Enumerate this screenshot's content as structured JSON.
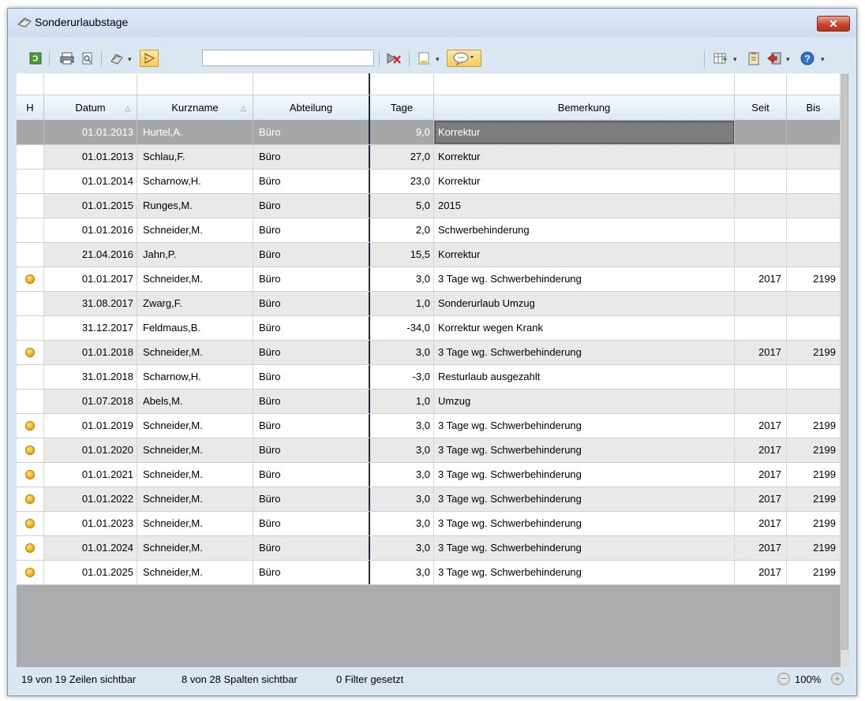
{
  "window": {
    "title": "Sonderurlaubstage",
    "close_label": "✕"
  },
  "toolbar": {
    "icons": [
      "refresh-icon",
      "print-icon",
      "print-preview-icon",
      "export-icon",
      "toggle-filter-icon",
      "clear-filter-icon",
      "document-icon",
      "comment-icon",
      "column-layout-icon",
      "clipboard-icon",
      "exit-icon",
      "help-icon"
    ],
    "search_value": ""
  },
  "grid": {
    "columns": [
      {
        "key": "h",
        "label": "H"
      },
      {
        "key": "datum",
        "label": "Datum",
        "sort": "asc"
      },
      {
        "key": "kurzname",
        "label": "Kurzname",
        "sort": "asc"
      },
      {
        "key": "abteilung",
        "label": "Abteilung"
      },
      {
        "key": "tage",
        "label": "Tage"
      },
      {
        "key": "bemerkung",
        "label": "Bemerkung"
      },
      {
        "key": "seit",
        "label": "Seit"
      },
      {
        "key": "bis",
        "label": "Bis"
      }
    ],
    "rows": [
      {
        "h": false,
        "datum": "01.01.2013",
        "kurzname": "Hurtel,A.",
        "abteilung": "Büro",
        "tage": "9,0",
        "bemerkung": "Korrektur",
        "seit": "",
        "bis": "",
        "selected": true
      },
      {
        "h": false,
        "datum": "01.01.2013",
        "kurzname": "Schlau,F.",
        "abteilung": "Büro",
        "tage": "27,0",
        "bemerkung": "Korrektur",
        "seit": "",
        "bis": ""
      },
      {
        "h": false,
        "datum": "01.01.2014",
        "kurzname": "Scharnow,H.",
        "abteilung": "Büro",
        "tage": "23,0",
        "bemerkung": "Korrektur",
        "seit": "",
        "bis": ""
      },
      {
        "h": false,
        "datum": "01.01.2015",
        "kurzname": "Runges,M.",
        "abteilung": "Büro",
        "tage": "5,0",
        "bemerkung": "2015",
        "seit": "",
        "bis": ""
      },
      {
        "h": false,
        "datum": "01.01.2016",
        "kurzname": "Schneider,M.",
        "abteilung": "Büro",
        "tage": "2,0",
        "bemerkung": "Schwerbehinderung",
        "seit": "",
        "bis": ""
      },
      {
        "h": false,
        "datum": "21.04.2016",
        "kurzname": "Jahn,P.",
        "abteilung": "Büro",
        "tage": "15,5",
        "bemerkung": "Korrektur",
        "seit": "",
        "bis": ""
      },
      {
        "h": true,
        "datum": "01.01.2017",
        "kurzname": "Schneider,M.",
        "abteilung": "Büro",
        "tage": "3,0",
        "bemerkung": "3 Tage wg. Schwerbehinderung",
        "seit": "2017",
        "bis": "2199"
      },
      {
        "h": false,
        "datum": "31.08.2017",
        "kurzname": "Zwarg,F.",
        "abteilung": "Büro",
        "tage": "1,0",
        "bemerkung": "Sonderurlaub Umzug",
        "seit": "",
        "bis": ""
      },
      {
        "h": false,
        "datum": "31.12.2017",
        "kurzname": "Feldmaus,B.",
        "abteilung": "Büro",
        "tage": "-34,0",
        "bemerkung": "Korrektur wegen Krank",
        "seit": "",
        "bis": ""
      },
      {
        "h": true,
        "datum": "01.01.2018",
        "kurzname": "Schneider,M.",
        "abteilung": "Büro",
        "tage": "3,0",
        "bemerkung": "3 Tage wg. Schwerbehinderung",
        "seit": "2017",
        "bis": "2199"
      },
      {
        "h": false,
        "datum": "31.01.2018",
        "kurzname": "Scharnow,H.",
        "abteilung": "Büro",
        "tage": "-3,0",
        "bemerkung": "Resturlaub ausgezahlt",
        "seit": "",
        "bis": ""
      },
      {
        "h": false,
        "datum": "01.07.2018",
        "kurzname": "Abels,M.",
        "abteilung": "Büro",
        "tage": "1,0",
        "bemerkung": "Umzug",
        "seit": "",
        "bis": ""
      },
      {
        "h": true,
        "datum": "01.01.2019",
        "kurzname": "Schneider,M.",
        "abteilung": "Büro",
        "tage": "3,0",
        "bemerkung": "3 Tage wg. Schwerbehinderung",
        "seit": "2017",
        "bis": "2199"
      },
      {
        "h": true,
        "datum": "01.01.2020",
        "kurzname": "Schneider,M.",
        "abteilung": "Büro",
        "tage": "3,0",
        "bemerkung": "3 Tage wg. Schwerbehinderung",
        "seit": "2017",
        "bis": "2199"
      },
      {
        "h": true,
        "datum": "01.01.2021",
        "kurzname": "Schneider,M.",
        "abteilung": "Büro",
        "tage": "3,0",
        "bemerkung": "3 Tage wg. Schwerbehinderung",
        "seit": "2017",
        "bis": "2199"
      },
      {
        "h": true,
        "datum": "01.01.2022",
        "kurzname": "Schneider,M.",
        "abteilung": "Büro",
        "tage": "3,0",
        "bemerkung": "3 Tage wg. Schwerbehinderung",
        "seit": "2017",
        "bis": "2199"
      },
      {
        "h": true,
        "datum": "01.01.2023",
        "kurzname": "Schneider,M.",
        "abteilung": "Büro",
        "tage": "3,0",
        "bemerkung": "3 Tage wg. Schwerbehinderung",
        "seit": "2017",
        "bis": "2199"
      },
      {
        "h": true,
        "datum": "01.01.2024",
        "kurzname": "Schneider,M.",
        "abteilung": "Büro",
        "tage": "3,0",
        "bemerkung": "3 Tage wg. Schwerbehinderung",
        "seit": "2017",
        "bis": "2199"
      },
      {
        "h": true,
        "datum": "01.01.2025",
        "kurzname": "Schneider,M.",
        "abteilung": "Büro",
        "tage": "3,0",
        "bemerkung": "3 Tage wg. Schwerbehinderung",
        "seit": "2017",
        "bis": "2199"
      }
    ]
  },
  "status": {
    "rows_visible": "19 von 19 Zeilen sichtbar",
    "cols_visible": "8 von 28 Spalten sichtbar",
    "filters": "0 Filter gesetzt",
    "zoom": "100%"
  },
  "colors": {
    "selected_row": "#a7a7a7",
    "alt_row": "#e9e9e9",
    "holiday_icon": "#f4b41a",
    "window_bg": "#dbe6f3"
  }
}
